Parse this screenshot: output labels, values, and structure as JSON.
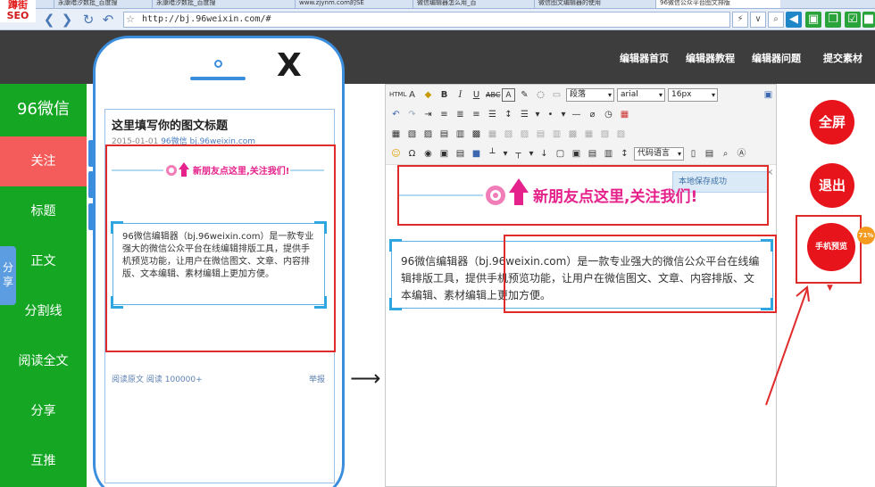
{
  "browser": {
    "logo_top": "蹲街",
    "logo_bottom": "SEO",
    "tabs": [
      "永康暗汐数批_百度搜",
      "永康暗汐数批_百度搜",
      "www.zjynm.com的SE",
      "微信编辑器怎么用_百",
      "微信图文编辑器的使用",
      "96微信公众平台图文排版"
    ],
    "url": "http://bj.96weixin.com/#",
    "colors": {
      "tabbar": "#d7e3f3",
      "address_bar": "#e9eff8"
    }
  },
  "topnav": {
    "items": [
      "编辑器首页",
      "编辑器教程",
      "编辑器问题",
      "提交素材"
    ]
  },
  "sidebar": {
    "brand": "96微信",
    "share": "分享",
    "items": [
      {
        "label": "关注",
        "active": true
      },
      {
        "label": "标题",
        "active": false
      },
      {
        "label": "正文",
        "active": false
      },
      {
        "label": "分割线",
        "active": false
      },
      {
        "label": "阅读全文",
        "active": false
      },
      {
        "label": "分享",
        "active": false
      },
      {
        "label": "互推",
        "active": false
      }
    ],
    "colors": {
      "background": "#15a724",
      "active": "#f45b5b"
    }
  },
  "phone": {
    "close_mark": "X",
    "article_title": "这里填写你的图文标题",
    "date": "2015-01-01",
    "account": "96微信 bj.96weixin.com",
    "banner_text": "新朋友点这里,关注我们!",
    "body_text": "96微信编辑器（bj.96weixin.com）是一款专业强大的微信公众平台在线编辑排版工具，提供手机预览功能，让用户在微信图文、文章、内容排版、文本编辑、素材编辑上更加方便。",
    "read_original": "阅读原文",
    "read_count": "阅读 100000+",
    "report": "举报"
  },
  "editor": {
    "toolbar": {
      "paragraph_select": "段落",
      "font_select": "arial",
      "size_select": "16px",
      "code_select": "代码语言"
    },
    "save_tip": "本地保存成功",
    "banner_text": "新朋友点这里,关注我们!",
    "body_text": "96微信编辑器（bj.96weixin.com）是一款专业强大的微信公众平台在线编辑排版工具，提供手机预览功能，让用户在微信图文、文章、内容排版、文本编辑、素材编辑上更加方便。"
  },
  "actions": {
    "fullscreen": "全屏",
    "exit": "退出",
    "mobile_preview": "手机预览",
    "progress_badge": "71%",
    "colors": {
      "button": "#e8141c",
      "highlight_frame": "#e02b2b"
    }
  }
}
